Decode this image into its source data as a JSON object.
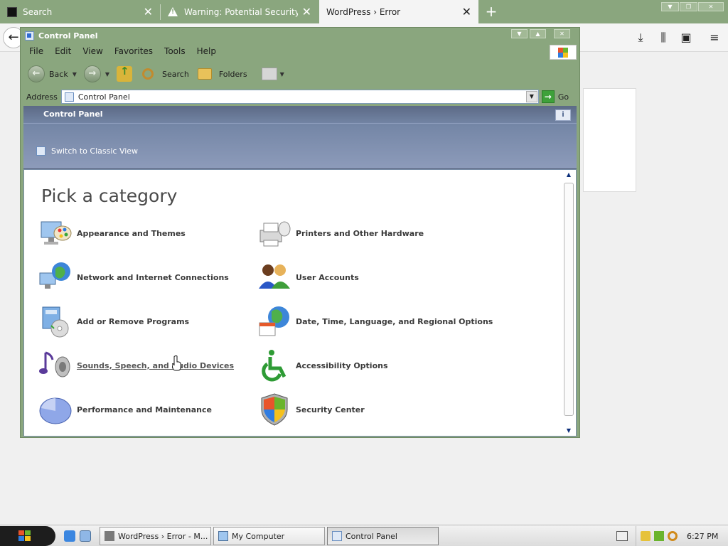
{
  "browser": {
    "tabs": [
      {
        "title": "Search",
        "close": "✕"
      },
      {
        "title": "Warning: Potential Security Risk",
        "close": "✕"
      },
      {
        "title": "WordPress › Error",
        "close": "✕"
      }
    ],
    "new_tab": "+",
    "back_glyph": "←",
    "toolbar_icons": {
      "download": "⤓",
      "library": "⫼",
      "sidebar": "▣",
      "menu": "≡"
    }
  },
  "control_panel": {
    "title": "Control Panel",
    "menu": [
      "File",
      "Edit",
      "View",
      "Favorites",
      "Tools",
      "Help"
    ],
    "toolbar": {
      "back": "Back",
      "search": "Search",
      "folders": "Folders"
    },
    "address": {
      "label": "Address",
      "value": "Control Panel",
      "go": "Go"
    },
    "header": {
      "title": "Control Panel",
      "switch_view": "Switch to Classic View"
    },
    "content": {
      "heading": "Pick a category",
      "categories": [
        {
          "label": "Appearance and Themes",
          "icon": "appearance-icon"
        },
        {
          "label": "Printers and Other Hardware",
          "icon": "printer-icon"
        },
        {
          "label": "Network and Internet Connections",
          "icon": "network-icon"
        },
        {
          "label": "User Accounts",
          "icon": "user-accounts-icon"
        },
        {
          "label": "Add or Remove Programs",
          "icon": "add-remove-icon"
        },
        {
          "label": "Date, Time, Language, and Regional Options",
          "icon": "globe-icon"
        },
        {
          "label": "Sounds, Speech, and Audio Devices",
          "icon": "sound-icon"
        },
        {
          "label": "Accessibility Options",
          "icon": "accessibility-icon"
        },
        {
          "label": "Performance and Maintenance",
          "icon": "performance-icon"
        },
        {
          "label": "Security Center",
          "icon": "shield-icon"
        }
      ]
    }
  },
  "taskbar": {
    "tasks": [
      "WordPress › Error - M...",
      "My Computer",
      "Control Panel"
    ],
    "clock": "6:27 PM"
  },
  "colors": {
    "chrome_green": "#8aa67e",
    "header_blue": "#7486a6",
    "go_green": "#3ea13a"
  }
}
